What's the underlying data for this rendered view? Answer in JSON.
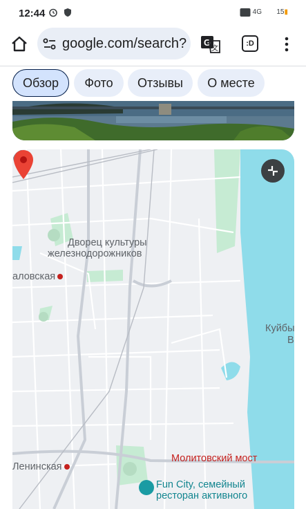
{
  "status_bar": {
    "time": "12:44",
    "signal_text": "4G",
    "battery": "15"
  },
  "browser": {
    "url": "google.com/search?",
    "tabs_label": ":D"
  },
  "chips": [
    {
      "label": "Обзор",
      "active": true
    },
    {
      "label": "Фото",
      "active": false
    },
    {
      "label": "Отзывы",
      "active": false
    },
    {
      "label": "О месте",
      "active": false
    }
  ],
  "map": {
    "poi_title_line1": "Дворец культуры",
    "poi_title_line2": "железнодорожников",
    "metro_left": "аловская",
    "metro_bottom": "Ленинская",
    "right_label_1": "Куйбы",
    "right_label_2": "В",
    "bridge_label": "Молитовский мост",
    "fun_city_line1": "Fun City, семейный",
    "fun_city_line2": "ресторан активного"
  },
  "colors": {
    "chip_bg": "#e8eef9",
    "chip_active_bg": "#d3e3fd",
    "water": "#8fdcea",
    "park": "#c6ebd3",
    "pin_red": "#ea4335"
  }
}
